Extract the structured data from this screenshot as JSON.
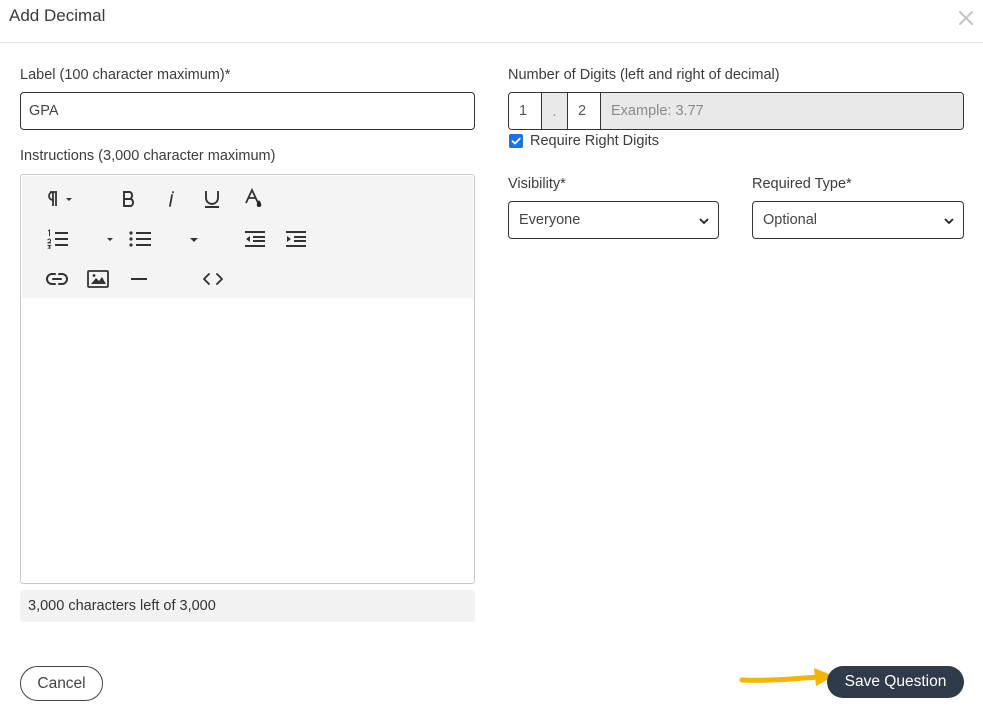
{
  "dialog": {
    "title": "Add Decimal",
    "close_icon": "close-icon"
  },
  "label_field": {
    "label": "Label (100 character maximum)*",
    "value": "GPA"
  },
  "instructions": {
    "label": "Instructions (3,000 character maximum)",
    "toolbar_icons": [
      "paragraph-icon",
      "bold-icon",
      "italic-icon",
      "underline-icon",
      "font-color-icon",
      "ordered-list-icon",
      "unordered-list-icon",
      "outdent-icon",
      "indent-icon",
      "link-icon",
      "image-icon",
      "horizontal-rule-icon",
      "code-view-icon"
    ],
    "counter": "3,000 characters left of 3,000"
  },
  "digits": {
    "label": "Number of Digits (left and right of decimal)",
    "left_value": "1",
    "separator": ".",
    "right_value": "2",
    "example_placeholder": "Example: 3.77",
    "require_right_label": "Require Right Digits",
    "require_right_checked": true
  },
  "visibility": {
    "label": "Visibility*",
    "selected": "Everyone"
  },
  "required_type": {
    "label": "Required Type*",
    "selected": "Optional"
  },
  "footer": {
    "cancel_label": "Cancel",
    "save_label": "Save Question",
    "accent_color": "#f4b400"
  },
  "colors": {
    "primary_button": "#2f3a4a",
    "checkbox": "#1a73e8"
  }
}
